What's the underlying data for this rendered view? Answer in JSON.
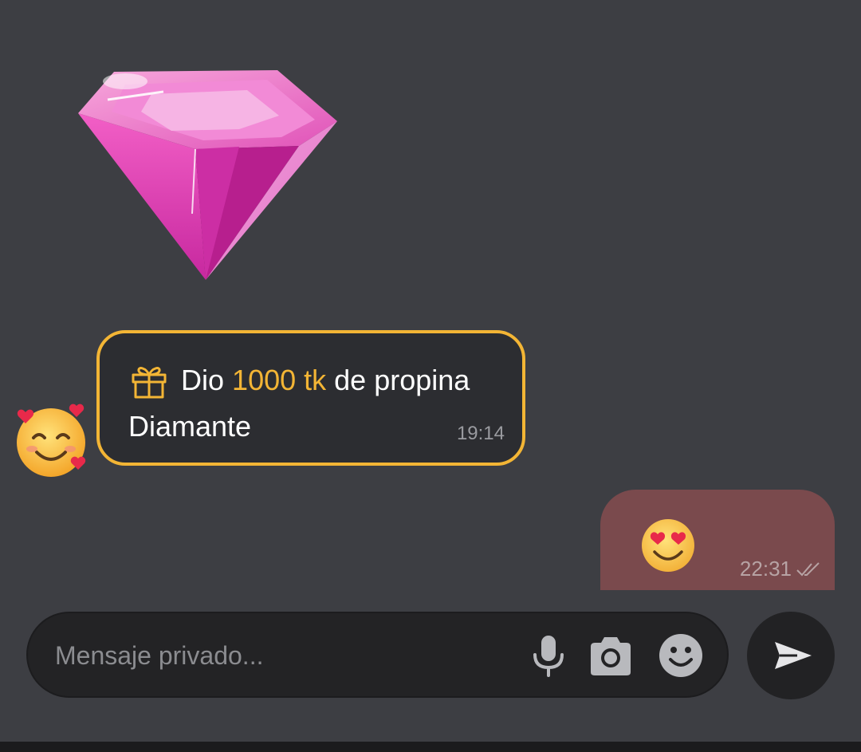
{
  "sticker": {
    "icon": "pink-diamond-icon"
  },
  "tip_message": {
    "icon": "gift-icon",
    "prefix": "Dio",
    "amount": "1000 tk",
    "suffix": "de propina",
    "gift_name": "Diamante",
    "time": "19:14",
    "accent_color": "#f3b535"
  },
  "sender": {
    "avatar_icon": "smiling-face-with-hearts-emoji"
  },
  "outgoing_message": {
    "emoji": "heart-eyes-emoji",
    "time": "22:31",
    "status_icon": "double-check-icon",
    "bubble_color": "#7a4a4d"
  },
  "composer": {
    "placeholder": "Mensaje privado...",
    "value": "",
    "icons": [
      "mic-icon",
      "camera-icon",
      "emoji-icon"
    ]
  },
  "send_button": {
    "icon": "send-icon"
  },
  "theme": {
    "background": "#3d3e43"
  }
}
